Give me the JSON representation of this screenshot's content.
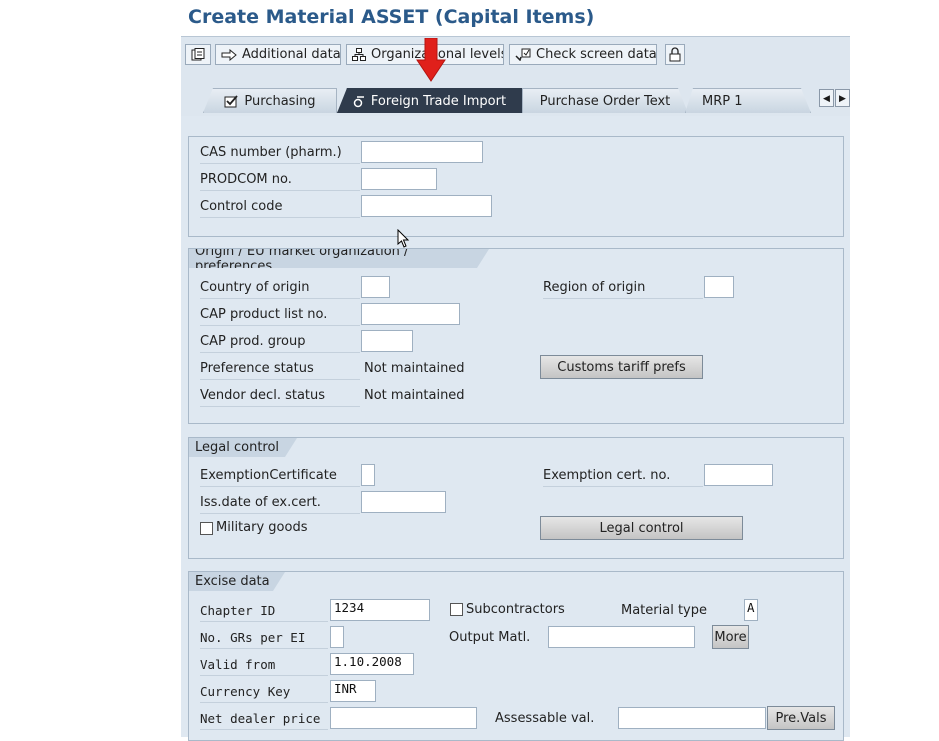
{
  "title": "Create Material ASSET (Capital Items)",
  "toolbar": {
    "additional_data": "Additional data",
    "org_levels": "Organizational levels",
    "check_screen_data": "Check screen data"
  },
  "tabs": [
    {
      "label": "Purchasing"
    },
    {
      "label": "Foreign Trade Import"
    },
    {
      "label": "Purchase Order Text"
    },
    {
      "label": "MRP 1"
    }
  ],
  "top_section": {
    "cas_label": "CAS number (pharm.)",
    "cas_value": "",
    "prodcom_label": "PRODCOM no.",
    "prodcom_value": "",
    "control_code_label": "Control code",
    "control_code_value": ""
  },
  "origin": {
    "title": "Origin / EU market organization / preferences",
    "country_label": "Country of origin",
    "country_value": "",
    "region_label": "Region of origin",
    "region_value": "",
    "cap_list_label": "CAP product list no.",
    "cap_list_value": "",
    "cap_group_label": "CAP prod. group",
    "cap_group_value": "",
    "pref_status_label": "Preference status",
    "pref_status_value": "Not maintained",
    "vendor_decl_label": "Vendor decl. status",
    "vendor_decl_value": "Not maintained",
    "customs_btn": "Customs tariff prefs"
  },
  "legal": {
    "title": "Legal control",
    "exemption_label": "ExemptionCertificate",
    "exemption_value": "",
    "exemption_no_label": "Exemption cert. no.",
    "exemption_no_value": "",
    "iss_date_label": "Iss.date of ex.cert.",
    "iss_date_value": "",
    "military_label": "Military goods",
    "legal_btn": "Legal control"
  },
  "excise": {
    "title": "Excise data",
    "chapter_label": "Chapter ID",
    "chapter_value": "1234",
    "subcontractors_label": "Subcontractors",
    "mat_type_label": "Material type",
    "mat_type_value": "A",
    "grs_label": "No. GRs per EI",
    "grs_value": "",
    "output_label": "Output Matl.",
    "output_value": "",
    "more_btn": "More",
    "valid_label": "Valid from",
    "valid_value": "1.10.2008",
    "currency_label": "Currency Key",
    "currency_value": "INR",
    "net_price_label": "Net dealer price",
    "net_price_value": "",
    "assessable_label": "Assessable val.",
    "assessable_value": "",
    "prevals_btn": "Pre.Vals"
  }
}
